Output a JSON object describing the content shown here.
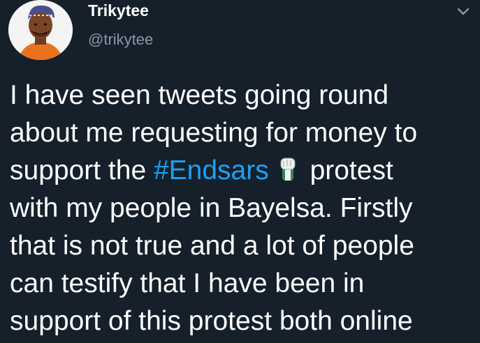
{
  "user": {
    "display_name": "Trikytee",
    "handle": "@trikytee"
  },
  "tweet": {
    "line1": "I have seen tweets going round",
    "line2": "about me requesting for money to",
    "line3_before": "support the ",
    "line3_hashtag": "#Endsars",
    "line3_after": " protest",
    "line4": "with my people in Bayelsa. Firstly",
    "line5": "that is not true and a lot of people",
    "line6": "can testify that I have been in",
    "line7": "support of this protest both online",
    "emoji": "raised-fist-emoji"
  },
  "colors": {
    "background": "#15202b",
    "text": "#ffffff",
    "handle": "#8899a6",
    "hashtag": "#1da1f2"
  },
  "icons": {
    "menu": "chevron-down-icon"
  }
}
